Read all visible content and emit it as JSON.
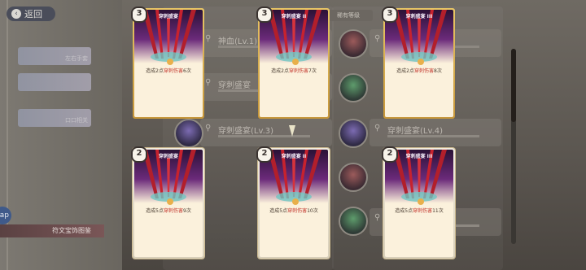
{
  "nav": {
    "back_label": "返回"
  },
  "side_cards": [
    "左右手套",
    "",
    "口口相关"
  ],
  "ap_label": "ap",
  "footer_tag": "符文宝饰图鉴",
  "rarity_filter": "稀有等级",
  "list_rows": [
    {
      "name": "神血(Lv.1)"
    },
    {
      "name": "穿刺盛宴"
    },
    {
      "name": "穿刺盛宴(Lv.3)"
    },
    {
      "name": "穿刺盛宴(Lv.4)"
    },
    {
      "name": ""
    },
    {
      "name": ""
    }
  ],
  "cards": [
    {
      "cost": "3",
      "title": "穿刺盛宴",
      "desc_pre": "造成2点",
      "desc_red": "穿刺伤害",
      "desc_post": "6次",
      "frame": "gold"
    },
    {
      "cost": "3",
      "title": "穿刺盛宴 II",
      "desc_pre": "造成2点",
      "desc_red": "穿刺伤害",
      "desc_post": "7次",
      "frame": "gold"
    },
    {
      "cost": "3",
      "title": "穿刺盛宴 III",
      "desc_pre": "造成2点",
      "desc_red": "穿刺伤害",
      "desc_post": "8次",
      "frame": "gold"
    },
    {
      "cost": "2",
      "title": "穿刺盛宴",
      "desc_pre": "造成5点",
      "desc_red": "穿刺伤害",
      "desc_post": "9次",
      "frame": "silver"
    },
    {
      "cost": "2",
      "title": "穿刺盛宴 II",
      "desc_pre": "造成5点",
      "desc_red": "穿刺伤害",
      "desc_post": "10次",
      "frame": "silver"
    },
    {
      "cost": "2",
      "title": "穿刺盛宴 III",
      "desc_pre": "造成5点",
      "desc_red": "穿刺伤害",
      "desc_post": "11次",
      "frame": "silver"
    }
  ],
  "colors": {
    "gold_frame": "#d8ae4e",
    "damage_red": "#c2342b",
    "card_bg": "#fbf1dc"
  }
}
